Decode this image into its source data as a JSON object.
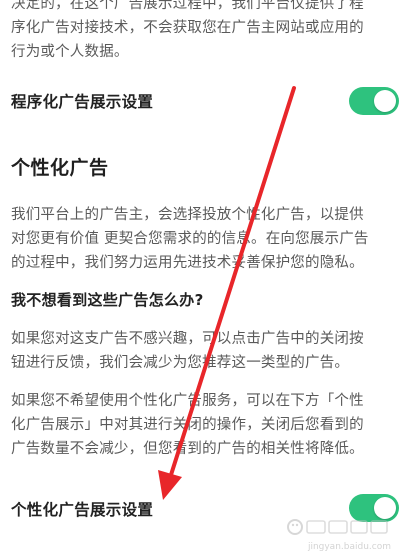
{
  "top_text": {
    "line1": "决定的，在这个广告展示过程中，我们平台仅提供了程",
    "line2": "序化广告对接技术，不会获取您在广告主网站或应用的",
    "line3": "行为或个人数据。"
  },
  "programmatic_setting": {
    "label": "程序化广告展示设置",
    "enabled": true
  },
  "personalized_section": {
    "heading": "个性化广告",
    "intro": {
      "line1": "我们平台上的广告主，会选择投放个性化广告，以提供",
      "line2": "对您更有价值 更契合您需求的的信息。在向您展示广告",
      "line3": "的过程中，我们努力运用先进技术妥善保护您的隐私。"
    },
    "faq_heading": "我不想看到这些广告怎么办?",
    "faq_para1": {
      "line1": "如果您对这支广告不感兴趣，可以点击广告中的关闭按",
      "line2": "钮进行反馈，我们会减少为您推荐这一类型的广告。"
    },
    "faq_para2": {
      "line1": "如果您不希望使用个性化广告服务，可以在下方「个性",
      "line2": "化广告展示」中对其进行关闭的操作，关闭后您看到的",
      "line3": "广告数量不会减少，但您看到的广告的相关性将降低。"
    }
  },
  "personalized_setting": {
    "label": "个性化广告展示设置",
    "enabled": true
  },
  "annotation": {
    "arrow_color": "#e8262a"
  },
  "colors": {
    "toggle_on": "#2ec27e",
    "text_body": "#5a5a5a",
    "text_heading": "#1f1f1f"
  },
  "watermark": {
    "text": "jingyan.baidu.com"
  }
}
